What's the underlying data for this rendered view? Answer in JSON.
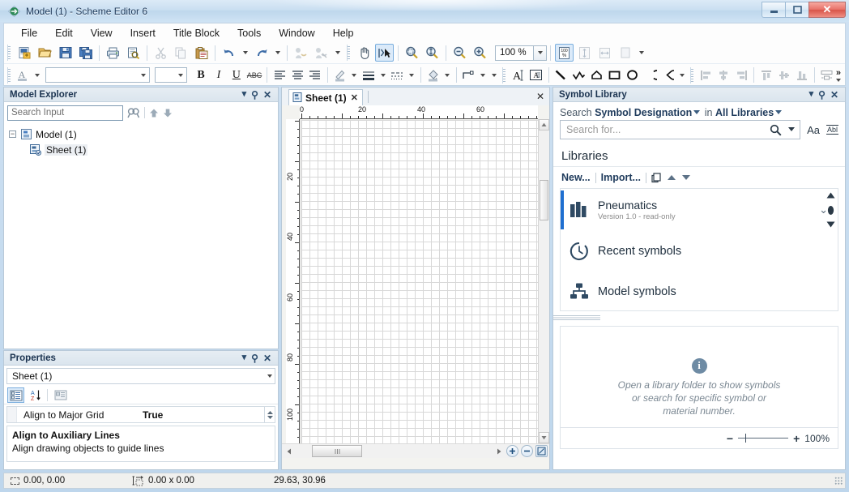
{
  "window": {
    "title": "Model (1) - Scheme Editor 6",
    "app_icon": "scheme-editor-icon",
    "minimize": "–",
    "maximize": "▫",
    "close": "✕"
  },
  "menu": {
    "items": [
      "File",
      "Edit",
      "View",
      "Insert",
      "Title Block",
      "Tools",
      "Window",
      "Help"
    ]
  },
  "toolbar": {
    "zoom_value": "100 %",
    "font_family_value": "",
    "font_size_value": "",
    "bold": "B",
    "italic": "I",
    "underline": "U",
    "strikethrough": "ABC",
    "overflow": "»",
    "row1_icons": [
      "new-document-icon",
      "open-folder-icon",
      "save-icon",
      "save-all-icon",
      "print-icon",
      "print-preview-icon",
      "cut-icon",
      "copy-icon",
      "paste-icon",
      "undo-icon",
      "redo-icon",
      "insert-connection-icon",
      "delete-connection-icon",
      "pan-hand-icon",
      "select-pointer-icon",
      "zoom-window-icon",
      "zoom-fit-icon",
      "zoom-out-icon",
      "zoom-in-icon",
      "zoom-100-icon",
      "fit-height-icon",
      "fit-width-icon",
      "page-icon"
    ],
    "row2_icons": [
      "font-color-icon",
      "align-left-icon",
      "align-center-icon",
      "align-right-icon",
      "line-color-icon",
      "line-weight-icon",
      "line-style-icon",
      "fill-color-icon",
      "connection-style-icon",
      "text-tool-icon",
      "text-box-icon",
      "line-shape-icon",
      "polyline-shape-icon",
      "polygon-shape-icon",
      "rectangle-shape-icon",
      "ellipse-shape-icon",
      "arc-shape-icon",
      "pie-shape-icon",
      "align-objects-left-icon",
      "align-objects-center-icon",
      "align-objects-right-icon",
      "align-objects-top-icon",
      "align-objects-middle-icon",
      "align-objects-bottom-icon",
      "distribute-icon"
    ]
  },
  "explorer": {
    "title": "Model Explorer",
    "search_placeholder": "Search Input",
    "search_value": "",
    "tools": [
      "find-icon",
      "move-up-icon",
      "move-down-icon"
    ],
    "panel_buttons": [
      "dropdown-menu-icon",
      "pin-icon",
      "close-icon"
    ],
    "tree": {
      "root_label": "Model (1)",
      "root_expander": "−",
      "child_label": "Sheet (1)"
    }
  },
  "properties": {
    "title": "Properties",
    "panel_buttons": [
      "dropdown-menu-icon",
      "pin-icon",
      "close-icon"
    ],
    "selected_object": "Sheet (1)",
    "toolbar_buttons": [
      "categorized-icon",
      "alphabetical-sort-icon",
      "property-pages-icon"
    ],
    "row": {
      "name": "Align to Major Grid",
      "value": "True"
    },
    "help": {
      "title": "Align to Auxiliary Lines",
      "text": "Align drawing objects to guide lines"
    }
  },
  "canvas": {
    "tab_label": "Sheet (1)",
    "tab_icon": "sheet-icon",
    "tab_close": "✕",
    "document_close": "✕",
    "ruler_h_labels": [
      "0",
      "20",
      "40",
      "60"
    ],
    "ruler_v_labels": [
      "20",
      "40",
      "60",
      "80",
      "100"
    ],
    "scroll_buttons": [
      "zoom-in-canvas-icon",
      "zoom-out-canvas-icon",
      "fit-page-icon"
    ]
  },
  "symbol_library": {
    "title": "Symbol Library",
    "panel_buttons": [
      "dropdown-menu-icon",
      "pin-icon",
      "close-icon"
    ],
    "scope_prefix": "Search",
    "scope_field": "Symbol Designation",
    "scope_in": "in",
    "scope_library": "All Libraries",
    "search_placeholder": "Search for...",
    "search_value": "",
    "search_icon": "magnifier-icon",
    "match_case_label": "Aa",
    "whole_word_label": "Abl",
    "libraries_header": "Libraries",
    "actions": {
      "new": "New...",
      "import": "Import..."
    },
    "action_icons": [
      "copy-library-icon",
      "move-up-icon",
      "move-down-icon"
    ],
    "entries": [
      {
        "name": "Pneumatics",
        "subtitle": "Version 1.0 - read-only",
        "icon": "library-books-icon",
        "selected": true
      },
      {
        "name": "Recent symbols",
        "subtitle": "",
        "icon": "clock-icon",
        "selected": false
      },
      {
        "name": "Model symbols",
        "subtitle": "",
        "icon": "hierarchy-icon",
        "selected": false
      }
    ],
    "empty_state": {
      "icon": "info-icon",
      "line1": "Open a library folder to show symbols",
      "line2": "or search for specific symbol or",
      "line3": "material number."
    },
    "zoom": {
      "minus": "−",
      "plus": "+",
      "value": "100%"
    }
  },
  "statusbar": {
    "cursor_position": "0.00, 0.00",
    "cursor_icon": "cursor-position-icon",
    "selection_size": "0.00 x 0.00",
    "size_icon": "selection-size-icon",
    "sheet_size": "29.63, 30.96"
  },
  "colors": {
    "accent_blue": "#1f6fd0",
    "title_text": "#1f3b5c",
    "panel_header_bg": "#e6edf3",
    "close_red": "#d85449"
  }
}
